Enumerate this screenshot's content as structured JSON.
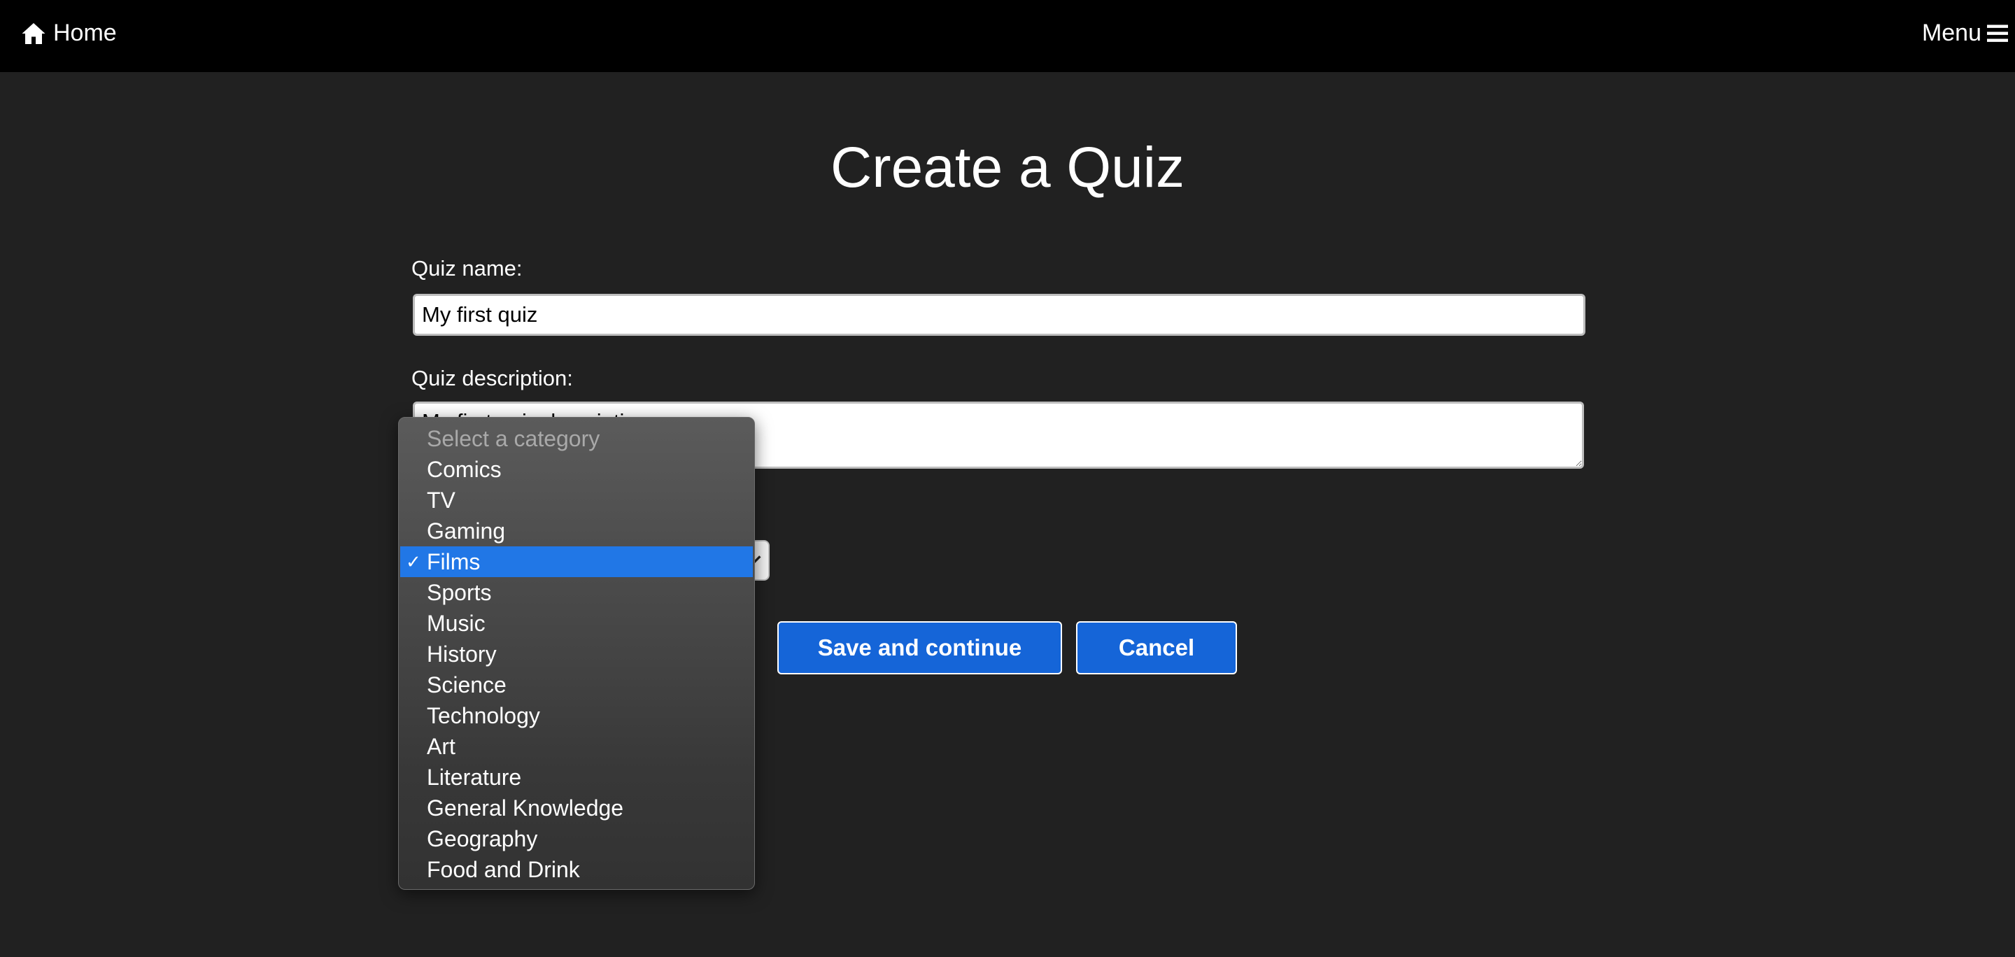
{
  "nav": {
    "home_label": "Home",
    "menu_label": "Menu"
  },
  "page": {
    "title": "Create a Quiz"
  },
  "form": {
    "name_label": "Quiz name:",
    "name_value": "My first quiz",
    "description_label": "Quiz description:",
    "description_value": "My first quiz description",
    "category_selected": "Films"
  },
  "buttons": {
    "save_label": "Save and continue",
    "cancel_label": "Cancel"
  },
  "dropdown": {
    "placeholder": "Select a category",
    "check_mark": "✓",
    "options": [
      "Comics",
      "TV",
      "Gaming",
      "Films",
      "Sports",
      "Music",
      "History",
      "Science",
      "Technology",
      "Art",
      "Literature",
      "General Knowledge",
      "Geography",
      "Food and Drink"
    ]
  },
  "colors": {
    "navbar": "#000000",
    "background": "#212121",
    "button": "#1565d8",
    "selected_option": "#2177e6"
  }
}
